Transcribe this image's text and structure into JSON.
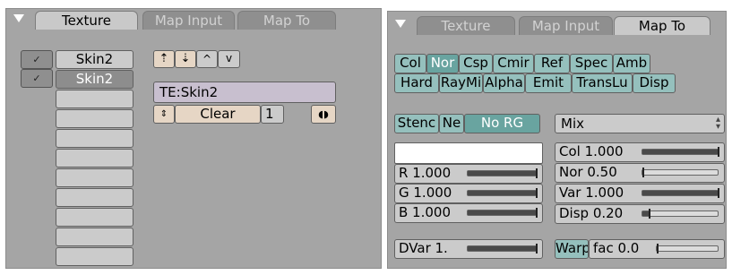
{
  "left_panel": {
    "tabs": [
      "Texture",
      "Map Input",
      "Map To"
    ],
    "slots": [
      "Skin2",
      "Skin2",
      "",
      "",
      "",
      "",
      "",
      "",
      "",
      "",
      ""
    ],
    "slot_checks": [
      "✓",
      "✓"
    ],
    "move_buttons": [
      "⇡",
      "⇣",
      "^",
      "v"
    ],
    "texture_name": "TE:Skin2",
    "clear_label": "Clear",
    "users_count": "1"
  },
  "right_panel": {
    "tabs": [
      "Texture",
      "Map Input",
      "Map To"
    ],
    "map_to_row1": [
      "Col",
      "Nor",
      "Csp",
      "Cmir",
      "Ref",
      "Spec",
      "Amb"
    ],
    "map_to_row2": [
      "Hard",
      "RayMi",
      "Alpha",
      "Emit",
      "TransLu",
      "Disp"
    ],
    "stencil_buttons": [
      "Stenc",
      "Ne",
      "No RG"
    ],
    "blend_mode": "Mix",
    "rgb_sliders": [
      {
        "label": "R 1.000",
        "value": 1.0
      },
      {
        "label": "G 1.000",
        "value": 1.0
      },
      {
        "label": "B 1.000",
        "value": 1.0
      }
    ],
    "dvar_slider": {
      "label": "DVar 1.",
      "value": 1.0
    },
    "factor_sliders": [
      {
        "label": "Col 1.000",
        "value": 1.0
      },
      {
        "label": "Nor 0.50",
        "value": 0.02
      },
      {
        "label": "Var 1.000",
        "value": 1.0
      },
      {
        "label": "Disp 0.20",
        "value": 0.1
      }
    ],
    "warp_label": "Warp",
    "warp_fac": {
      "label": "fac 0.0",
      "value": 0.0
    }
  }
}
